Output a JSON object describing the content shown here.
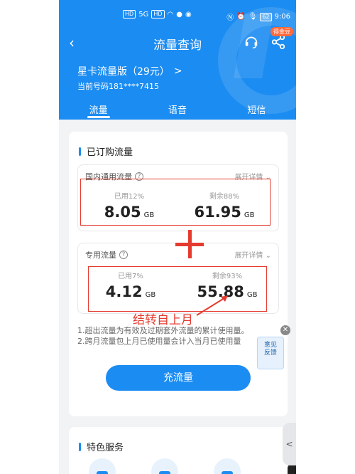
{
  "status": {
    "left_icons": [
      "HD",
      "5G",
      "HD",
      "Wi-Fi",
      "chat",
      "msg"
    ],
    "battery": "62",
    "time": "9:06"
  },
  "nav": {
    "back_icon": "chevron-left-icon",
    "title": "流量查询",
    "badge": "得金豆"
  },
  "plan": {
    "name": "星卡流量版（29元）",
    "arrow": ">",
    "number": "当前号码181****7415"
  },
  "tabs": [
    {
      "label": "流量",
      "active": true
    },
    {
      "label": "语音"
    },
    {
      "label": "短信"
    }
  ],
  "subscribed": {
    "title": "已订购流量",
    "domestic": {
      "label": "国内通用流量",
      "help": "?",
      "expand": "展开详情",
      "used_label": "已用12%",
      "used_value": "8.05",
      "remain_label": "剩余88%",
      "remain_value": "61.95",
      "unit": "GB"
    },
    "dedicated": {
      "label": "专用流量",
      "help": "?",
      "expand": "展开详情",
      "used_label": "已用7%",
      "used_value": "4.12",
      "remain_label": "剩余93%",
      "remain_value": "55.88",
      "unit": "GB"
    },
    "annotation": "结转自上月",
    "notes": [
      "1.超出流量为有效及过期套外流量的累计使用量。",
      "2.跨月流量包上月已使用量会计入当月已使用量"
    ],
    "charge_button": "充流量"
  },
  "feedback": {
    "label_line1": "意见",
    "label_line2": "反馈",
    "close": "✕"
  },
  "featured": {
    "title": "特色服务"
  },
  "side_handle": "<",
  "colors": {
    "primary": "#1b8cf2",
    "annotation_red": "#e53b2f"
  }
}
